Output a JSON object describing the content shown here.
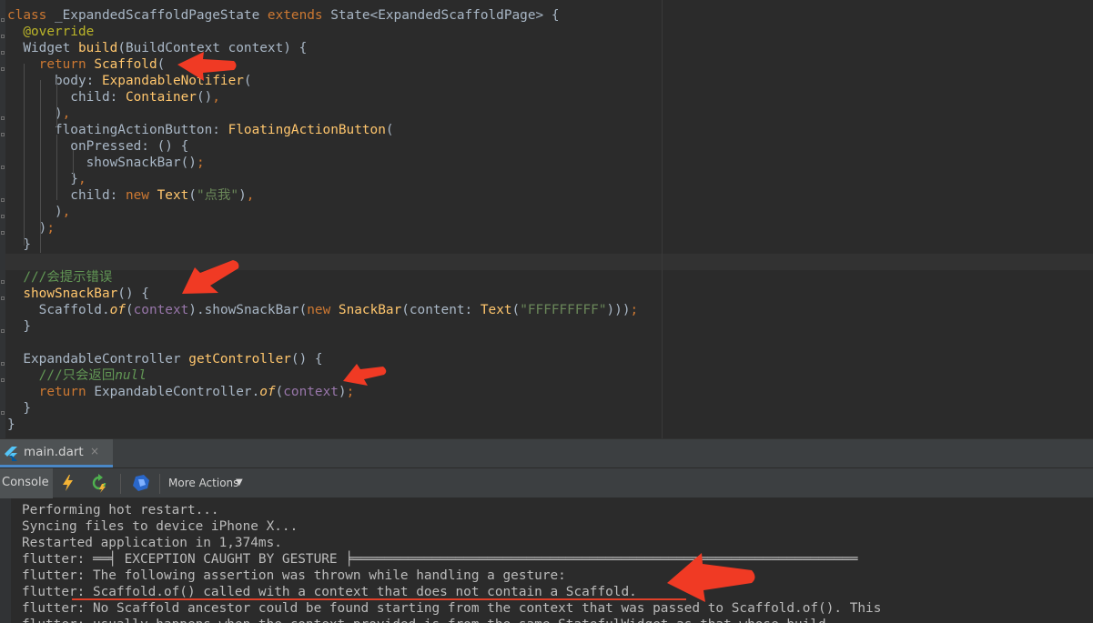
{
  "editor": {
    "lines": [
      {
        "segments": [
          {
            "t": "class ",
            "c": "kw"
          },
          {
            "t": "_ExpandedScaffoldPageState ",
            "c": ""
          },
          {
            "t": "extends ",
            "c": "kw"
          },
          {
            "t": "State<ExpandedScaffoldPage> {",
            "c": ""
          }
        ]
      },
      {
        "segments": [
          {
            "t": "  ",
            "c": ""
          },
          {
            "t": "@override",
            "c": "ann"
          }
        ]
      },
      {
        "segments": [
          {
            "t": "  Widget ",
            "c": ""
          },
          {
            "t": "build",
            "c": "fn"
          },
          {
            "t": "(BuildContext context) {",
            "c": ""
          }
        ]
      },
      {
        "segments": [
          {
            "t": "    ",
            "c": ""
          },
          {
            "t": "return ",
            "c": "kw"
          },
          {
            "t": "Scaffold",
            "c": "fn"
          },
          {
            "t": "(",
            "c": ""
          }
        ]
      },
      {
        "segments": [
          {
            "t": "      body: ",
            "c": ""
          },
          {
            "t": "ExpandableNotifier",
            "c": "fn"
          },
          {
            "t": "(",
            "c": ""
          }
        ]
      },
      {
        "segments": [
          {
            "t": "        child: ",
            "c": ""
          },
          {
            "t": "Container",
            "c": "fn"
          },
          {
            "t": "()",
            "c": ""
          },
          {
            "t": ",",
            "c": "kw"
          }
        ]
      },
      {
        "segments": [
          {
            "t": "      )",
            "c": ""
          },
          {
            "t": ",",
            "c": "kw"
          }
        ]
      },
      {
        "segments": [
          {
            "t": "      floatingActionButton: ",
            "c": ""
          },
          {
            "t": "FloatingActionButton",
            "c": "fn"
          },
          {
            "t": "(",
            "c": ""
          }
        ]
      },
      {
        "segments": [
          {
            "t": "        onPressed: () {",
            "c": ""
          }
        ]
      },
      {
        "segments": [
          {
            "t": "          showSnackBar()",
            "c": ""
          },
          {
            "t": ";",
            "c": "kw"
          }
        ]
      },
      {
        "segments": [
          {
            "t": "        }",
            "c": ""
          },
          {
            "t": ",",
            "c": "kw"
          }
        ]
      },
      {
        "segments": [
          {
            "t": "        child: ",
            "c": ""
          },
          {
            "t": "new ",
            "c": "kw"
          },
          {
            "t": "Text",
            "c": "fn"
          },
          {
            "t": "(",
            "c": ""
          },
          {
            "t": "\"点我\"",
            "c": "str"
          },
          {
            "t": ")",
            "c": ""
          },
          {
            "t": ",",
            "c": "kw"
          }
        ]
      },
      {
        "segments": [
          {
            "t": "      )",
            "c": ""
          },
          {
            "t": ",",
            "c": "kw"
          }
        ]
      },
      {
        "segments": [
          {
            "t": "    )",
            "c": ""
          },
          {
            "t": ";",
            "c": "kw"
          }
        ]
      },
      {
        "segments": [
          {
            "t": "  }",
            "c": ""
          }
        ]
      },
      {
        "segments": []
      },
      {
        "segments": [
          {
            "t": "  ///会提示错误",
            "c": "cm"
          }
        ]
      },
      {
        "segments": [
          {
            "t": "  ",
            "c": ""
          },
          {
            "t": "showSnackBar",
            "c": "fn"
          },
          {
            "t": "() {",
            "c": ""
          }
        ]
      },
      {
        "segments": [
          {
            "t": "    Scaffold.",
            "c": ""
          },
          {
            "t": "of",
            "c": "ic"
          },
          {
            "t": "(",
            "c": ""
          },
          {
            "t": "context",
            "c": "par"
          },
          {
            "t": ").showSnackBar(",
            "c": ""
          },
          {
            "t": "new ",
            "c": "kw"
          },
          {
            "t": "SnackBar",
            "c": "fn"
          },
          {
            "t": "(content: ",
            "c": ""
          },
          {
            "t": "Text",
            "c": "fn"
          },
          {
            "t": "(",
            "c": ""
          },
          {
            "t": "\"FFFFFFFFF\"",
            "c": "str"
          },
          {
            "t": ")))",
            "c": ""
          },
          {
            "t": ";",
            "c": "kw"
          }
        ]
      },
      {
        "segments": [
          {
            "t": "  }",
            "c": ""
          }
        ]
      },
      {
        "segments": []
      },
      {
        "segments": [
          {
            "t": "  ExpandableController ",
            "c": ""
          },
          {
            "t": "getController",
            "c": "fn"
          },
          {
            "t": "() {",
            "c": ""
          }
        ]
      },
      {
        "segments": [
          {
            "t": "    ///只会返回",
            "c": "cm"
          },
          {
            "t": "null",
            "c": "cmi"
          }
        ]
      },
      {
        "segments": [
          {
            "t": "    ",
            "c": ""
          },
          {
            "t": "return ",
            "c": "kw"
          },
          {
            "t": "ExpandableController.",
            "c": ""
          },
          {
            "t": "of",
            "c": "ic"
          },
          {
            "t": "(",
            "c": ""
          },
          {
            "t": "context",
            "c": "par"
          },
          {
            "t": ")",
            "c": ""
          },
          {
            "t": ";",
            "c": "kw"
          }
        ]
      },
      {
        "segments": [
          {
            "t": "  }",
            "c": ""
          }
        ]
      },
      {
        "segments": [
          {
            "t": "}",
            "c": ""
          }
        ]
      }
    ]
  },
  "file_tab": {
    "label": "main.dart",
    "close": "×"
  },
  "run_toolbar": {
    "console_label": "Console",
    "more_actions_label": "More Actions",
    "icons": [
      "flash-icon",
      "hot-restart-icon",
      "dart-devtools-icon",
      "dropdown-caret-icon"
    ]
  },
  "console": {
    "lines": [
      "Performing hot restart...",
      "Syncing files to device iPhone X...",
      "Restarted application in 1,374ms.",
      "flutter: ══╡ EXCEPTION CAUGHT BY GESTURE ╞════════════════════════════════════════════════════════════════",
      "flutter: The following assertion was thrown while handling a gesture:",
      "flutter: Scaffold.of() called with a context that does not contain a Scaffold.",
      "flutter: No Scaffold ancestor could be found starting from the context that was passed to Scaffold.of(). This",
      "flutter: usually happens when the context provided is from the same StatefulWidget as that whose build"
    ]
  },
  "colors": {
    "annotation_arrow": "#f03a24",
    "underline": "#e0412a"
  }
}
